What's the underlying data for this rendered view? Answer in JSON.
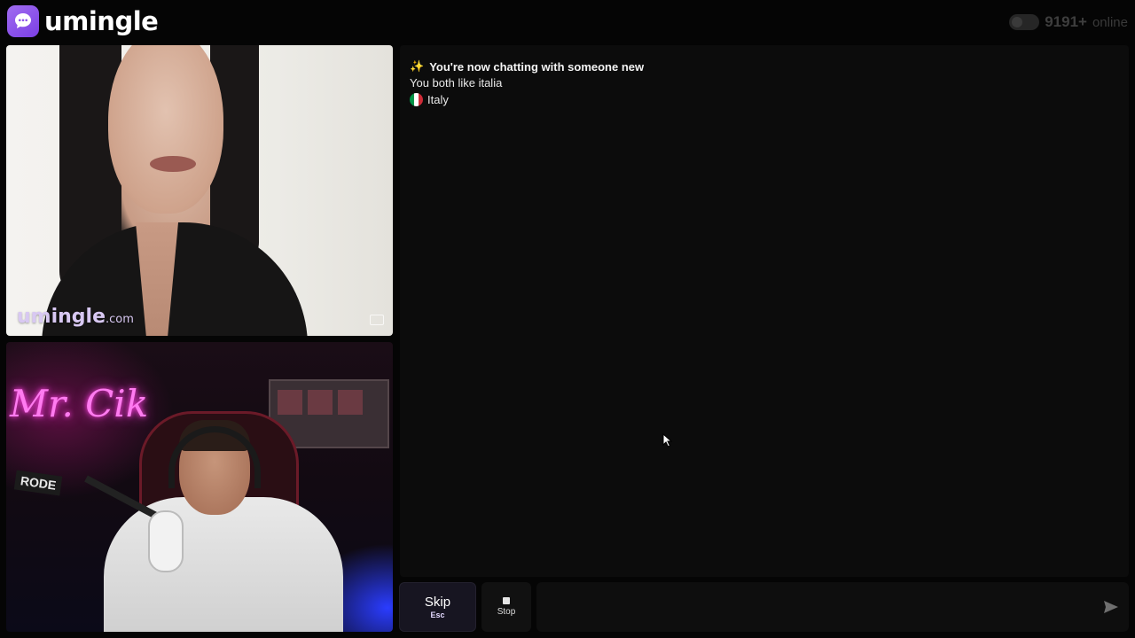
{
  "app": {
    "brand": "umingle",
    "online_count": "9191+",
    "online_label": "online"
  },
  "stranger_video": {
    "watermark_brand": "umingle",
    "watermark_domain": ".com"
  },
  "self_video": {
    "neon_sign": "Mr. Cik",
    "mic_brand": "RODE"
  },
  "chat": {
    "intro_icon": "sparkle-icon",
    "intro_title": "You're now chatting with someone new",
    "shared_interest": "You both like italia",
    "country_flag": "italy-flag-icon",
    "country": "Italy"
  },
  "controls": {
    "skip_label": "Skip",
    "skip_key": "Esc",
    "stop_label": "Stop",
    "message_placeholder": ""
  },
  "colors": {
    "brand_accent": "#8b52ea",
    "background": "#050505",
    "panel": "#0c0c0c",
    "skip_button": "#171521"
  }
}
